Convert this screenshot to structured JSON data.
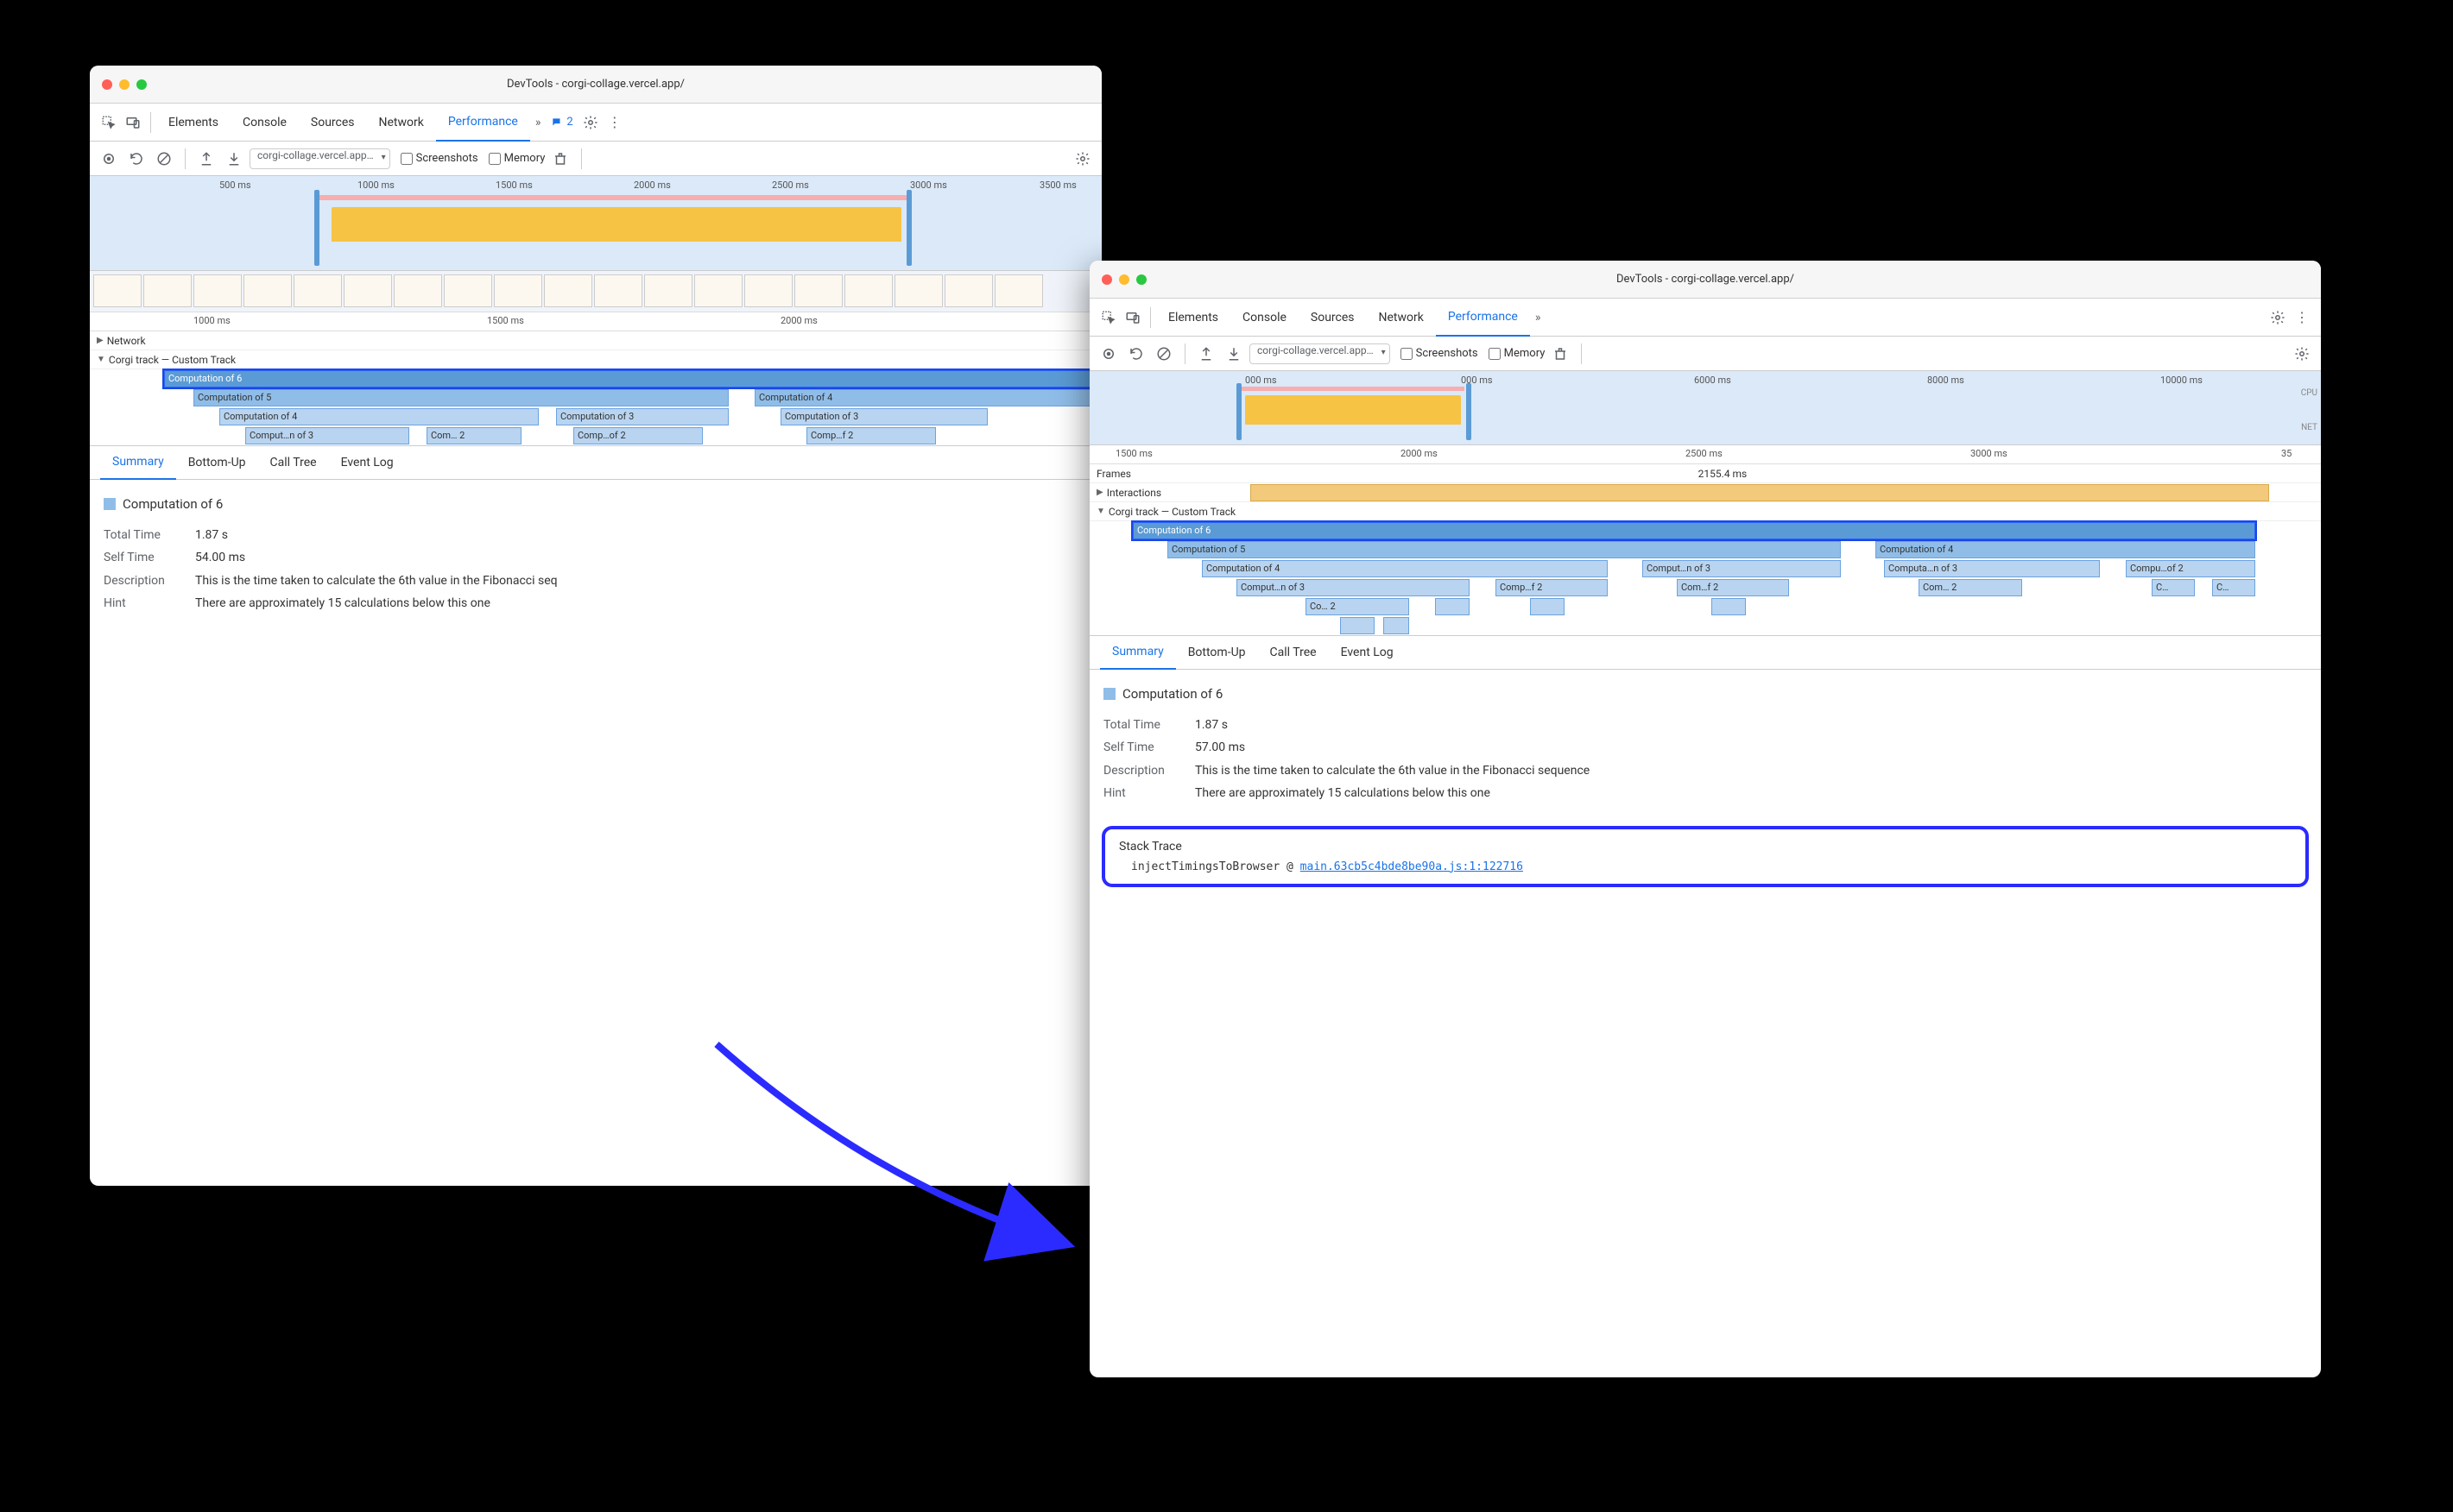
{
  "title": "DevTools - corgi-collage.vercel.app/",
  "tabs": {
    "elements": "Elements",
    "console": "Console",
    "sources": "Sources",
    "network": "Network",
    "performance": "Performance"
  },
  "more_count": "2",
  "toolbar": {
    "recording": "corgi-collage.vercel.app…",
    "screenshots": "Screenshots",
    "memory": "Memory"
  },
  "w1": {
    "overview_ticks": [
      "500 ms",
      "1000 ms",
      "1500 ms",
      "2000 ms",
      "2500 ms",
      "3000 ms",
      "3500 ms"
    ],
    "ruler_ticks": [
      "1000 ms",
      "1500 ms",
      "2000 ms"
    ],
    "net_section": "Network",
    "track_section": "Corgi track — Custom Track",
    "rows": {
      "r0": "Computation of 6",
      "r1a": "Computation of 5",
      "r1b": "Computation of 4",
      "r2a": "Computation of 4",
      "r2b": "Computation of 3",
      "r2c": "Computation of 3",
      "r3a": "Comput…n of 3",
      "r3b": "Com… 2",
      "r3c": "Comp…of 2",
      "r3d": "Comp…f 2"
    }
  },
  "w2": {
    "overview_ticks": [
      "000 ms",
      "000 ms",
      "6000 ms",
      "8000 ms",
      "10000 ms"
    ],
    "cpu": "CPU",
    "net": "NET",
    "ruler_ticks": [
      "1500 ms",
      "2000 ms",
      "2500 ms",
      "3000 ms",
      "35"
    ],
    "frames_label": "Frames",
    "frames_value": "2155.4 ms",
    "interactions_label": "Interactions",
    "track_section": "Corgi track — Custom Track",
    "rows": {
      "r0": "Computation of 6",
      "r1a": "Computation of 5",
      "r1b": "Computation of 4",
      "r2a": "Computation of 4",
      "r2b": "Comput…n of 3",
      "r2c": "Computa…n of 3",
      "r2d": "Compu…of 2",
      "r3a": "Comput…n of 3",
      "r3b": "Comp…f 2",
      "r3c": "Com…f 2",
      "r3d": "Com… 2",
      "r3e": "C…",
      "r3f": "C…",
      "r4a": "Co… 2"
    }
  },
  "subtabs": {
    "summary": "Summary",
    "bottomup": "Bottom-Up",
    "calltree": "Call Tree",
    "eventlog": "Event Log"
  },
  "details1": {
    "heading": "Computation of 6",
    "total_time_label": "Total Time",
    "total_time": "1.87 s",
    "self_time_label": "Self Time",
    "self_time": "54.00 ms",
    "desc_label": "Description",
    "desc": "This is the time taken to calculate the 6th value in the Fibonacci seq",
    "hint_label": "Hint",
    "hint": "There are approximately 15 calculations below this one"
  },
  "details2": {
    "heading": "Computation of 6",
    "total_time_label": "Total Time",
    "total_time": "1.87 s",
    "self_time_label": "Self Time",
    "self_time": "57.00 ms",
    "desc_label": "Description",
    "desc": "This is the time taken to calculate the 6th value in the Fibonacci sequence",
    "hint_label": "Hint",
    "hint": "There are approximately 15 calculations below this one"
  },
  "stack": {
    "title": "Stack Trace",
    "func": "injectTimingsToBrowser",
    "at": "@",
    "loc": "main.63cb5c4bde8be90a.js:1:122716"
  }
}
